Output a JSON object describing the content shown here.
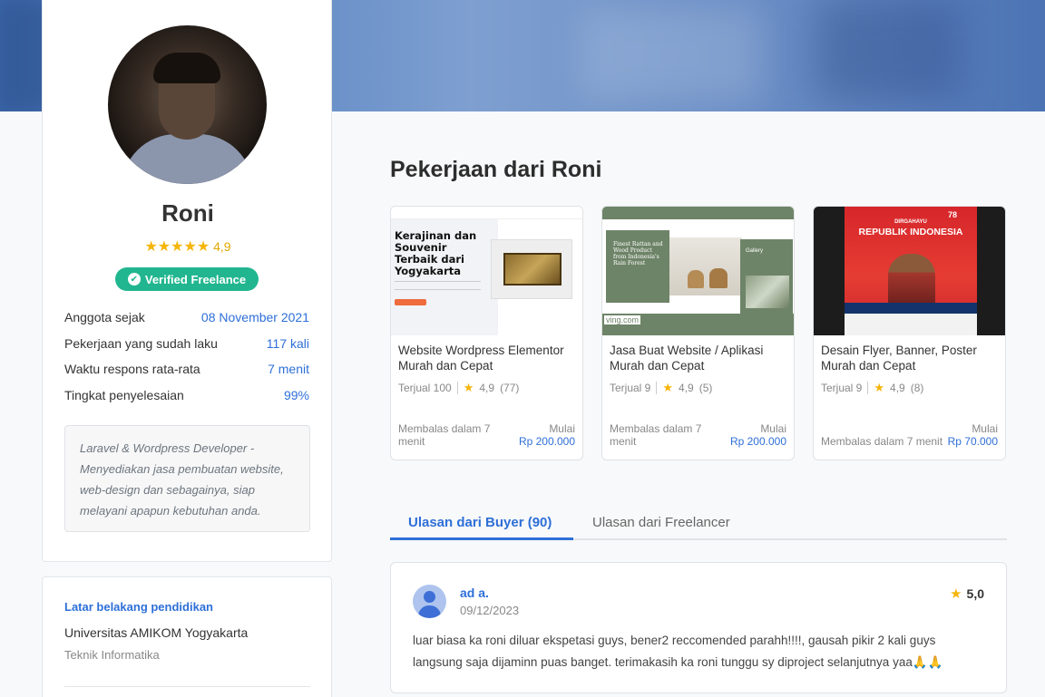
{
  "profile": {
    "name": "Roni",
    "stars_icon": "★★★★★",
    "rating": "4,9",
    "verified_label": "Verified Freelance",
    "stats": [
      {
        "label": "Anggota sejak",
        "value": "08 November 2021"
      },
      {
        "label": "Pekerjaan yang sudah laku",
        "value": "117 kali"
      },
      {
        "label": "Waktu respons rata-rata",
        "value": "7 menit"
      },
      {
        "label": "Tingkat penyelesaian",
        "value": "99%"
      }
    ],
    "bio": "Laravel & Wordpress Developer - Menyediakan jasa pembuatan website, web-design dan sebagainya, siap melayani apapun kebutuhan anda."
  },
  "education": {
    "title": "Latar belakang pendidikan",
    "university": "Universitas AMIKOM Yogyakarta",
    "major": "Teknik Informatika"
  },
  "jobs_section": {
    "title": "Pekerjaan dari Roni",
    "jobs": [
      {
        "title": "Website Wordpress Elementor Murah dan Cepat",
        "sold": "Terjual 100",
        "rating": "4,9",
        "reviews": "(77)",
        "response": "Membalas dalam 7 menit",
        "price_prefix": "Mulai",
        "price": "Rp 200.000",
        "thumb_text": "Kerajinan dan Souvenir Terbaik dari Yogyakarta"
      },
      {
        "title": "Jasa Buat Website / Aplikasi Murah dan Cepat",
        "sold": "Terjual 9",
        "rating": "4,9",
        "reviews": "(5)",
        "response": "Membalas dalam 7 menit",
        "price_prefix": "Mulai",
        "price": "Rp 200.000",
        "thumb_text": "Finest Rattan and Wood Product from Indonesia's Rain Forest",
        "thumb_gallery": "Gallery",
        "thumb_footer": "ving.com"
      },
      {
        "title": "Desain Flyer, Banner, Poster Murah dan Cepat",
        "sold": "Terjual 9",
        "rating": "4,9",
        "reviews": "(8)",
        "response": "Membalas dalam 7 menit",
        "price_prefix": "Mulai",
        "price": "Rp 70.000",
        "thumb_top": "DIRGAHAYU",
        "thumb_text": "REPUBLIK INDONESIA",
        "thumb_number": "78"
      }
    ]
  },
  "tabs": [
    {
      "label": "Ulasan dari Buyer (90)",
      "active": true
    },
    {
      "label": "Ulasan dari Freelancer",
      "active": false
    }
  ],
  "review": {
    "name": "ad a.",
    "date": "09/12/2023",
    "rating": "5,0",
    "text": "luar biasa ka roni diluar ekspetasi guys, bener2 reccomended parahh!!!!, gausah pikir 2 kali guys langsung saja dijaminn puas banget. terimakasih ka roni tunggu sy diproject selanjutnya yaa🙏🙏"
  },
  "icons": {
    "star": "star-icon",
    "check": "check-badge-icon",
    "avatar": "user-avatar-icon"
  },
  "colors": {
    "accent": "#2e6fd8",
    "verified": "#21b68f",
    "star": "#f5b50a"
  }
}
